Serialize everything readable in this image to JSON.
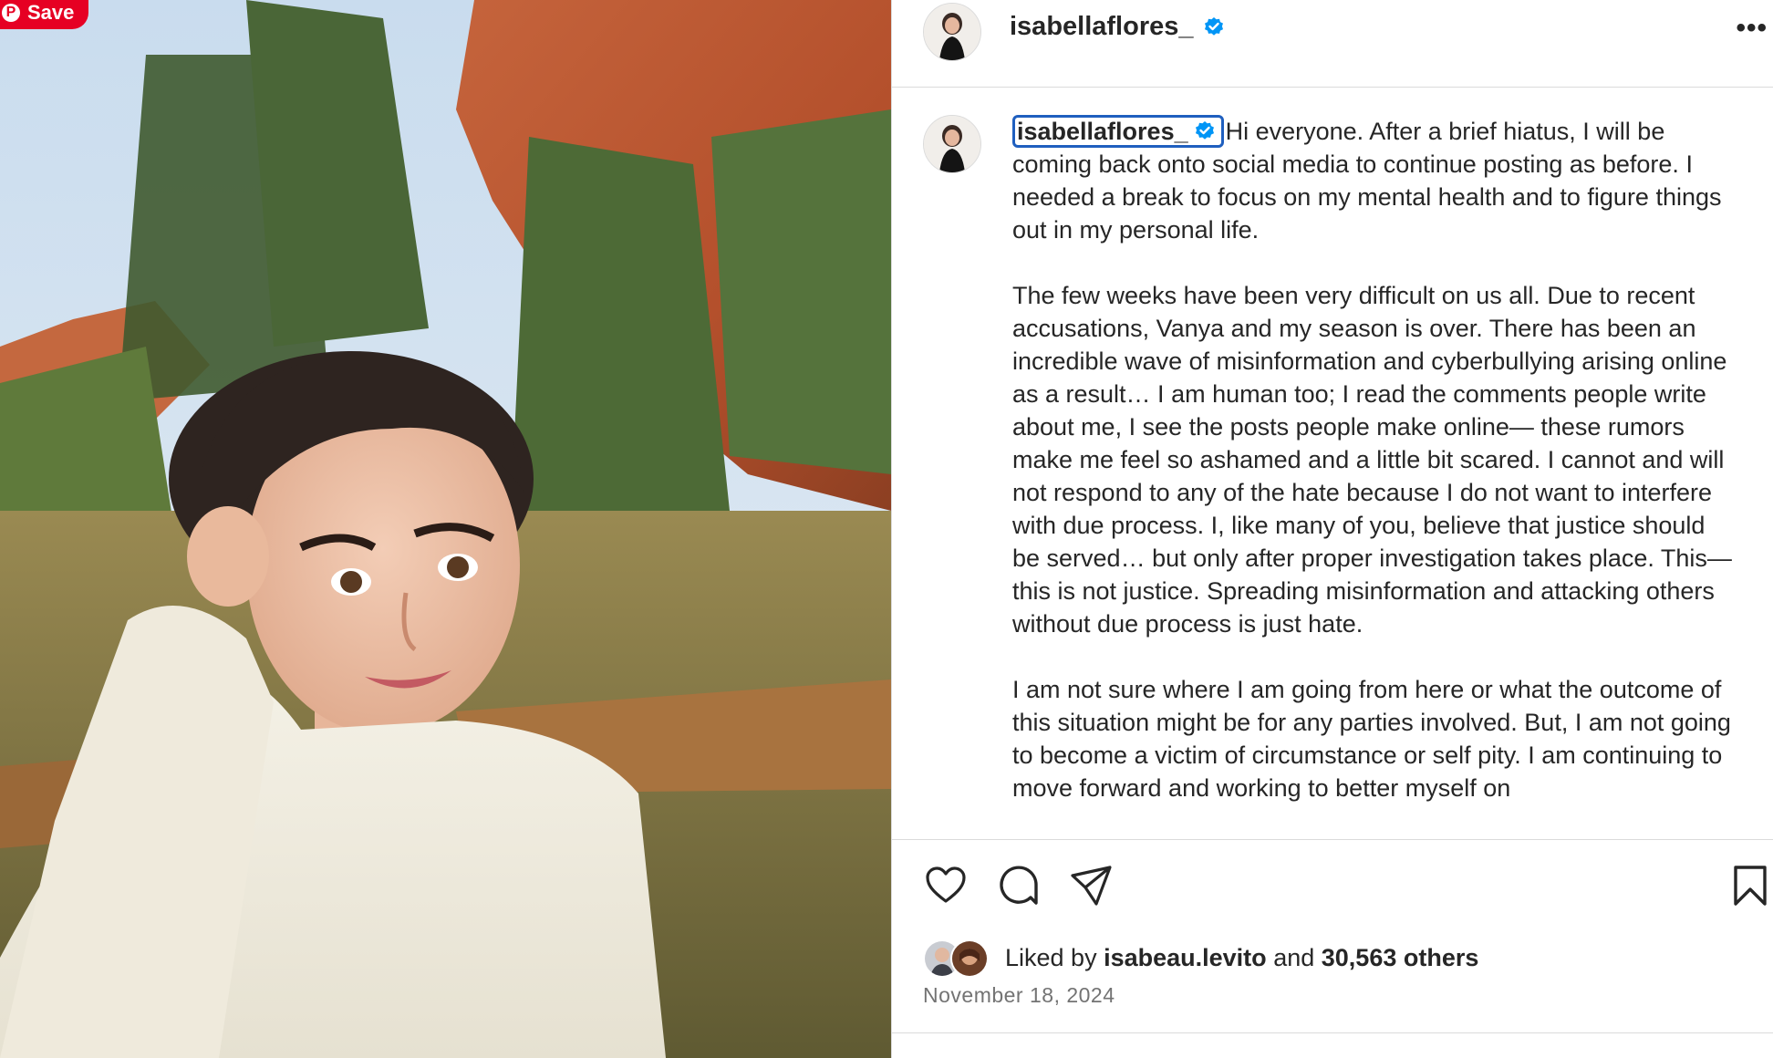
{
  "pin": {
    "save_label": "Save"
  },
  "post": {
    "username": "isabellaflores_",
    "verified": true,
    "caption_paragraphs": [
      "Hi everyone. After a brief hiatus, I will be coming back onto social media to continue posting as before. I needed a break to focus on my mental health and to figure things out in my personal life.",
      "The few weeks have been very difficult on us all. Due to recent accusations, Vanya and my season is over. There has been an incredible wave of misinformation and cyberbullying arising online as a result… I am human too; I read the comments people write about me, I see the posts people make online— these rumors make me feel so ashamed and a little bit scared. I cannot and will not respond to any of the hate because I do not want to interfere with due process. I, like many of you, believe that justice should be served… but only after proper investigation takes place. This— this is not justice. Spreading misinformation and attacking others without due process is just hate.",
      "I am not sure where I am going from here or what the outcome of this situation might be for any parties involved. But, I am not going to become a victim of circumstance or self pity. I am continuing to move forward and working to better myself on"
    ],
    "likes": {
      "prefix": "Liked by",
      "liker": "isabeau.levito",
      "joiner": "and",
      "others": "30,563 others"
    },
    "date": "November 18, 2024"
  },
  "icons": {
    "more": "more-options-icon",
    "like": "heart-icon",
    "comment": "comment-icon",
    "share": "send-icon",
    "save": "bookmark-icon",
    "verified": "verified-badge-icon"
  },
  "colors": {
    "pinterest_red": "#e60023",
    "verified_blue": "#0095f6",
    "text": "#262626",
    "muted": "#737373",
    "focus_ring": "#1f5fbf"
  }
}
